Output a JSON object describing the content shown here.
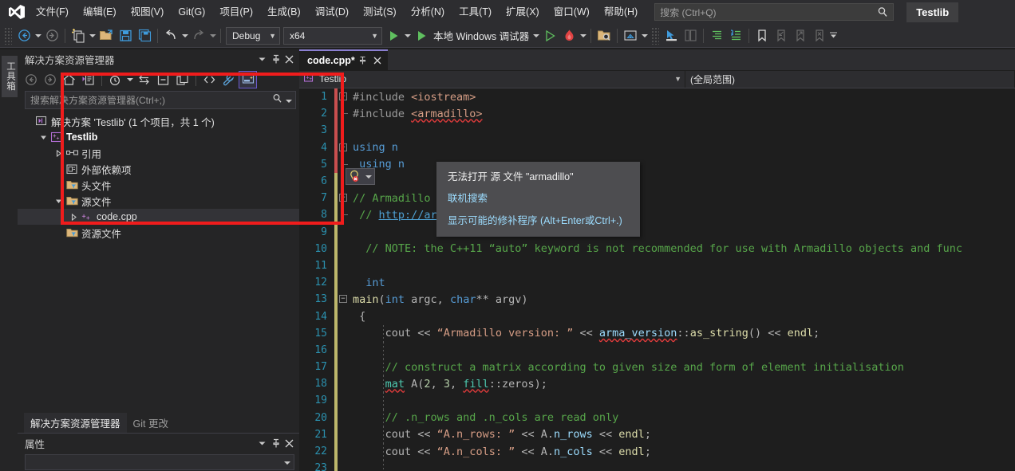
{
  "app": {
    "title": "Testlib",
    "logo_icon": "visual-studio-logo"
  },
  "menu": {
    "items": [
      {
        "label": "文件(F)"
      },
      {
        "label": "编辑(E)"
      },
      {
        "label": "视图(V)"
      },
      {
        "label": "Git(G)"
      },
      {
        "label": "项目(P)"
      },
      {
        "label": "生成(B)"
      },
      {
        "label": "调试(D)"
      },
      {
        "label": "测试(S)"
      },
      {
        "label": "分析(N)"
      },
      {
        "label": "工具(T)"
      },
      {
        "label": "扩展(X)"
      },
      {
        "label": "窗口(W)"
      },
      {
        "label": "帮助(H)"
      }
    ]
  },
  "search": {
    "placeholder": "搜索 (Ctrl+Q)",
    "icon": "search-icon"
  },
  "toolbar": {
    "navigate_back_icon": "navigate-back-icon",
    "navigate_forward_icon": "navigate-forward-icon",
    "new_item_icon": "new-item-icon",
    "open_file_icon": "open-file-icon",
    "save_icon": "save-icon",
    "save_all_icon": "save-all-icon",
    "undo_icon": "undo-icon",
    "redo_icon": "redo-icon",
    "configuration": "Debug",
    "platform": "x64",
    "start_icon": "start-debug-icon",
    "debug_target": "本地 Windows 调试器",
    "run_without_debug_icon": "start-without-debugging-icon",
    "hot_reload_icon": "hot-reload-icon",
    "solution_explorer_search_icon": "folder-search-icon",
    "home_folder_icon": "home-folder-icon",
    "pointer_icon": "select-tool-icon",
    "copy_panel_icon": "copy-panel-icon",
    "indent_icon": "increase-indent-icon",
    "outdent_icon": "comment-icon",
    "bookmark_icon": "bookmark-icon",
    "bookmark_prev_icon": "previous-bookmark-icon",
    "bookmark_next_icon": "next-bookmark-icon",
    "bookmark_clear_icon": "clear-bookmarks-icon",
    "overflow_icon": "toolbar-overflow-icon"
  },
  "vertical_tabs": [
    {
      "label": "工具箱"
    }
  ],
  "solution_explorer": {
    "title": "解决方案资源管理器",
    "dropdown_icon": "chevron-down-icon",
    "pin_icon": "pin-icon",
    "close_icon": "close-icon",
    "toolbar_icons": [
      "back-icon",
      "forward-icon",
      "home-icon",
      "switch-views-icon",
      "pending-changes-icon",
      "sync-with-active-document-icon",
      "collapse-all-icon",
      "show-all-files-icon",
      "view-code-icon",
      "properties-wrench-icon",
      "preview-selected-items-icon"
    ],
    "search_placeholder": "搜索解决方案资源管理器(Ctrl+;)",
    "search_icon": "search-icon",
    "tree": [
      {
        "label": "解决方案 'Testlib' (1 个项目，共 1 个)",
        "indent": 0,
        "twisty": "none",
        "icon": "solution-icon",
        "bold": false,
        "selected": false
      },
      {
        "label": "Testlib",
        "indent": 1,
        "twisty": "expanded",
        "icon": "cpp-project-icon",
        "bold": true,
        "selected": false
      },
      {
        "label": "引用",
        "indent": 2,
        "twisty": "collapsed",
        "icon": "references-icon",
        "bold": false,
        "selected": false
      },
      {
        "label": "外部依赖项",
        "indent": 2,
        "twisty": "none",
        "icon": "external-dependencies-icon",
        "bold": false,
        "selected": false
      },
      {
        "label": "头文件",
        "indent": 2,
        "twisty": "none",
        "icon": "filter-folder-icon",
        "bold": false,
        "selected": false
      },
      {
        "label": "源文件",
        "indent": 2,
        "twisty": "expanded",
        "icon": "filter-folder-icon",
        "bold": false,
        "selected": false
      },
      {
        "label": "code.cpp",
        "indent": 3,
        "twisty": "collapsed",
        "icon": "cpp-file-icon",
        "bold": false,
        "selected": true
      },
      {
        "label": "资源文件",
        "indent": 2,
        "twisty": "none",
        "icon": "filter-folder-icon",
        "bold": false,
        "selected": false
      }
    ]
  },
  "dock_tabs": [
    {
      "label": "解决方案资源管理器",
      "active": true
    },
    {
      "label": "Git 更改",
      "active": false
    }
  ],
  "properties_panel": {
    "title": "属性",
    "dropdown_icon": "chevron-down-icon",
    "pin_icon": "pin-icon",
    "close_icon": "close-icon",
    "selector_value": "",
    "selector_caret_icon": "chevron-down-icon"
  },
  "editor": {
    "tab": {
      "label": "code.cpp*",
      "pin_icon": "pin-icon",
      "close_icon": "close-icon"
    },
    "navbar": {
      "project": "Testlib",
      "project_icon": "cpp-project-icon",
      "scope": "(全局范围)",
      "caret_icon": "chevron-down-icon"
    },
    "error_adornment": {
      "icon": "quick-actions-error-icon",
      "caret_icon": "chevron-down-icon"
    },
    "tooltip": {
      "message": "无法打开 源 文件 \"armadillo\"",
      "link_search": "联机搜索",
      "link_fixes": "显示可能的修补程序 (Alt+Enter或Ctrl+.)"
    },
    "lines": [
      {
        "n": 1,
        "change": "err",
        "fold": "start",
        "indent_guides": [],
        "tokens": [
          {
            "t": "#include ",
            "c": "pp"
          },
          {
            "t": "<iostream>",
            "c": "inc"
          }
        ]
      },
      {
        "n": 2,
        "change": "err",
        "fold": "end",
        "indent_guides": [],
        "tokens": [
          {
            "t": "#include ",
            "c": "pp"
          },
          {
            "t": "<armadillo>",
            "c": "inc squig"
          }
        ]
      },
      {
        "n": 3,
        "change": "err",
        "fold": "none",
        "indent_guides": [],
        "tokens": []
      },
      {
        "n": 4,
        "change": "err",
        "fold": "start",
        "indent_guides": [],
        "tokens": [
          {
            "t": "using ",
            "c": "k"
          },
          {
            "t": "n",
            "c": "k"
          }
        ]
      },
      {
        "n": 5,
        "change": "err",
        "fold": "end",
        "indent_guides": [],
        "tokens": [
          {
            "t": " using ",
            "c": "k"
          },
          {
            "t": "n",
            "c": "k"
          }
        ]
      },
      {
        "n": 6,
        "change": "ok",
        "fold": "none",
        "indent_guides": [],
        "tokens": []
      },
      {
        "n": 7,
        "change": "ok",
        "fold": "start",
        "indent_guides": [],
        "tokens": [
          {
            "t": "// Armadillo documentation is available at:",
            "c": "cm"
          }
        ]
      },
      {
        "n": 8,
        "change": "ok",
        "fold": "end",
        "indent_guides": [],
        "tokens": [
          {
            "t": " // ",
            "c": "cm"
          },
          {
            "t": "http://arma.sourceforge.net/docs.html",
            "c": "lnk"
          }
        ]
      },
      {
        "n": 9,
        "change": "ok",
        "fold": "none",
        "indent_guides": [],
        "tokens": []
      },
      {
        "n": 10,
        "change": "ok",
        "fold": "none",
        "indent_guides": [],
        "tokens": [
          {
            "t": "  // NOTE: the C++11 “auto” keyword is not recommended for use with Armadillo objects and func",
            "c": "cm"
          }
        ]
      },
      {
        "n": 11,
        "change": "ok",
        "fold": "none",
        "indent_guides": [],
        "tokens": []
      },
      {
        "n": 12,
        "change": "ok",
        "fold": "none",
        "indent_guides": [],
        "tokens": [
          {
            "t": "  int",
            "c": "k"
          }
        ]
      },
      {
        "n": 13,
        "change": "ok",
        "fold": "start",
        "indent_guides": [],
        "tokens": [
          {
            "t": "main",
            "c": "fn"
          },
          {
            "t": "(",
            "c": "op"
          },
          {
            "t": "int",
            "c": "k"
          },
          {
            "t": " argc, ",
            "c": "op"
          },
          {
            "t": "char",
            "c": "k"
          },
          {
            "t": "** argv)",
            "c": "op"
          }
        ]
      },
      {
        "n": 14,
        "change": "ok",
        "fold": "none",
        "indent_guides": [],
        "tokens": [
          {
            "t": " {",
            "c": "op"
          }
        ]
      },
      {
        "n": 15,
        "change": "ok",
        "fold": "none",
        "indent_guides": [
          40
        ],
        "tokens": [
          {
            "t": "     cout ",
            "c": "op"
          },
          {
            "t": "<< ",
            "c": "op"
          },
          {
            "t": "“Armadillo version: ”",
            "c": "st"
          },
          {
            "t": " << ",
            "c": "op"
          },
          {
            "t": "arma_version",
            "c": "id squig"
          },
          {
            "t": "::",
            "c": "op"
          },
          {
            "t": "as_string",
            "c": "fn"
          },
          {
            "t": "() << ",
            "c": "op"
          },
          {
            "t": "endl",
            "c": "fn"
          },
          {
            "t": ";",
            "c": "op"
          }
        ]
      },
      {
        "n": 16,
        "change": "ok",
        "fold": "none",
        "indent_guides": [
          40
        ],
        "tokens": []
      },
      {
        "n": 17,
        "change": "ok",
        "fold": "none",
        "indent_guides": [
          40
        ],
        "tokens": [
          {
            "t": "     // construct a matrix according to given size and form of element initialisation",
            "c": "cm"
          }
        ]
      },
      {
        "n": 18,
        "change": "ok",
        "fold": "none",
        "indent_guides": [
          40
        ],
        "tokens": [
          {
            "t": "     ",
            "c": "op"
          },
          {
            "t": "mat",
            "c": "ty squig"
          },
          {
            "t": " A(",
            "c": "op"
          },
          {
            "t": "2",
            "c": "num"
          },
          {
            "t": ", ",
            "c": "op"
          },
          {
            "t": "3",
            "c": "num"
          },
          {
            "t": ", ",
            "c": "op"
          },
          {
            "t": "fill",
            "c": "ty squig"
          },
          {
            "t": "::zeros);",
            "c": "op"
          }
        ]
      },
      {
        "n": 19,
        "change": "ok",
        "fold": "none",
        "indent_guides": [
          40
        ],
        "tokens": []
      },
      {
        "n": 20,
        "change": "ok",
        "fold": "none",
        "indent_guides": [
          40
        ],
        "tokens": [
          {
            "t": "     // .n_rows and .n_cols are read only",
            "c": "cm"
          }
        ]
      },
      {
        "n": 21,
        "change": "ok",
        "fold": "none",
        "indent_guides": [
          40
        ],
        "tokens": [
          {
            "t": "     cout << ",
            "c": "op"
          },
          {
            "t": "“A.n_rows: ”",
            "c": "st"
          },
          {
            "t": " << A.",
            "c": "op"
          },
          {
            "t": "n_rows",
            "c": "id"
          },
          {
            "t": " << ",
            "c": "op"
          },
          {
            "t": "endl",
            "c": "fn"
          },
          {
            "t": ";",
            "c": "op"
          }
        ]
      },
      {
        "n": 22,
        "change": "ok",
        "fold": "none",
        "indent_guides": [
          40
        ],
        "tokens": [
          {
            "t": "     cout << ",
            "c": "op"
          },
          {
            "t": "“A.n_cols: ”",
            "c": "st"
          },
          {
            "t": " << A.",
            "c": "op"
          },
          {
            "t": "n_cols",
            "c": "id"
          },
          {
            "t": " << ",
            "c": "op"
          },
          {
            "t": "endl",
            "c": "fn"
          },
          {
            "t": ";",
            "c": "op"
          }
        ]
      },
      {
        "n": 23,
        "change": "ok",
        "fold": "none",
        "indent_guides": [
          40
        ],
        "tokens": []
      }
    ]
  },
  "colors": {
    "accent_purple": "#8a7fd0",
    "error_red": "#f01c1c",
    "chrome_bg": "#2d2d30",
    "panel_bg": "#252526",
    "editor_bg": "#1e1e1e",
    "linenum_blue": "#2b91af",
    "comment_green": "#57a64a",
    "string_orange": "#d69d85",
    "keyword_blue": "#569cd6"
  }
}
